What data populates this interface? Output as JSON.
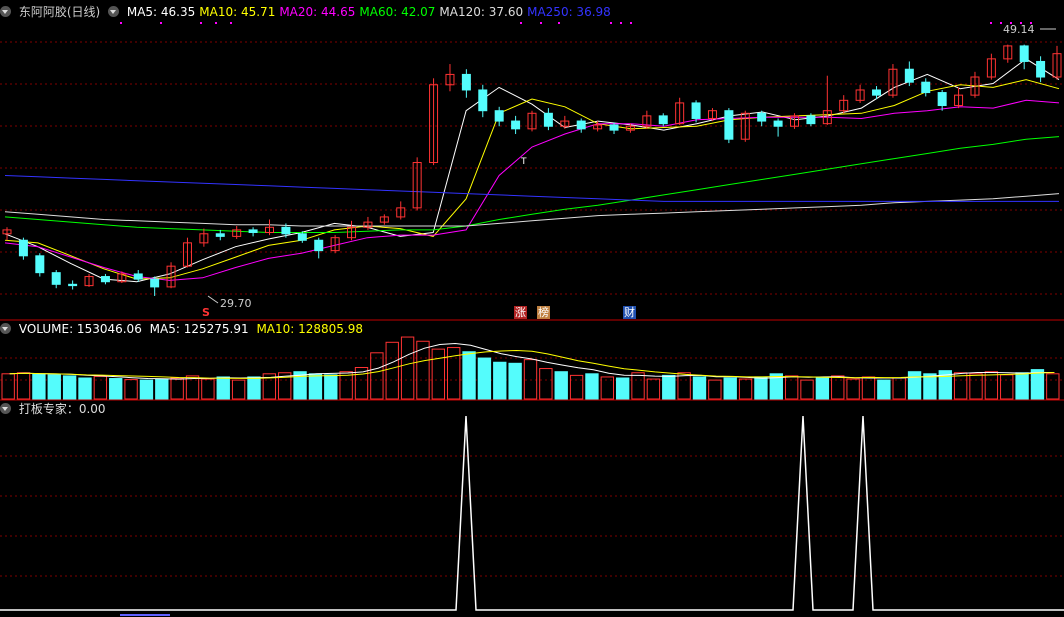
{
  "header": {
    "title": "东阿阿胶(日线)",
    "ma": [
      {
        "label": "MA5: 46.35",
        "color": "#ffffff"
      },
      {
        "label": "MA10: 45.71",
        "color": "#ffff00"
      },
      {
        "label": "MA20: 44.65",
        "color": "#ff00ff"
      },
      {
        "label": "MA60: 42.07",
        "color": "#00ff00"
      },
      {
        "label": "MA120: 37.60",
        "color": "#dddddd"
      },
      {
        "label": "MA250: 36.98",
        "color": "#3333ff"
      }
    ]
  },
  "volume_header": {
    "title": "VOLUME: 153046.06",
    "ma5": "MA5: 125275.91",
    "ma10": "MA10: 128805.98"
  },
  "indicator_header": {
    "title": "打板专家：0.00"
  },
  "annotations": {
    "high_label": "49.14",
    "low_label": "29.70",
    "s_marker": "S",
    "t_marker": "T",
    "zhang": "涨",
    "bang": "榜",
    "cai": "财"
  },
  "colors": {
    "up": "#ff3333",
    "down": "#54fcfc",
    "grid": "#800000"
  },
  "chart_data": [
    {
      "type": "line",
      "title": "东阿阿胶(日线)",
      "note": "price panel; values read approximately, right-most is latest",
      "ylim": [
        28,
        51
      ],
      "series": [
        {
          "name": "MA5",
          "values": [
            34.5,
            33.5,
            32.2,
            31.0,
            30.8,
            31.4,
            32.5,
            33.5,
            34.1,
            34.6,
            35.3,
            35.0,
            34.3,
            34.6,
            44.0,
            45.8,
            44.5,
            42.7,
            43.2,
            42.9,
            42.5,
            43.0,
            43.6,
            43.9,
            43.3,
            43.6,
            44.2,
            45.8,
            46.8,
            45.7,
            46.1,
            48.0,
            46.4
          ]
        },
        {
          "name": "MA10",
          "values": [
            34.0,
            33.8,
            32.8,
            31.8,
            31.0,
            31.1,
            31.8,
            32.7,
            33.6,
            34.0,
            34.8,
            35.1,
            34.9,
            34.3,
            37.2,
            43.8,
            44.9,
            44.3,
            43.0,
            42.6,
            42.7,
            42.8,
            43.3,
            43.5,
            43.6,
            43.7,
            43.8,
            44.4,
            45.5,
            46.0,
            45.8,
            46.4,
            45.7
          ]
        },
        {
          "name": "MA20",
          "values": [
            33.8,
            33.5,
            32.7,
            31.9,
            31.2,
            30.9,
            31.1,
            31.9,
            32.6,
            33.0,
            33.6,
            34.2,
            34.4,
            34.4,
            34.8,
            39.0,
            41.2,
            42.2,
            43.0,
            43.0,
            42.8,
            43.3,
            43.4,
            43.5,
            43.5,
            43.5,
            43.4,
            43.8,
            44.0,
            44.3,
            44.2,
            44.8,
            44.6
          ]
        },
        {
          "name": "MA60",
          "values": [
            35.8,
            35.6,
            35.4,
            35.2,
            35.0,
            34.9,
            34.8,
            34.7,
            34.6,
            34.6,
            34.6,
            34.7,
            34.8,
            34.8,
            35.1,
            35.6,
            36.0,
            36.4,
            36.7,
            37.1,
            37.5,
            37.9,
            38.3,
            38.7,
            39.1,
            39.5,
            39.9,
            40.3,
            40.7,
            41.1,
            41.4,
            41.8,
            42.0
          ]
        },
        {
          "name": "MA120",
          "values": [
            36.2,
            36.0,
            35.8,
            35.6,
            35.5,
            35.4,
            35.3,
            35.2,
            35.2,
            35.1,
            35.1,
            35.1,
            35.1,
            35.1,
            35.1,
            35.3,
            35.5,
            35.7,
            35.9,
            36.0,
            36.1,
            36.2,
            36.3,
            36.4,
            36.5,
            36.6,
            36.7,
            36.9,
            37.0,
            37.1,
            37.2,
            37.4,
            37.6
          ]
        },
        {
          "name": "MA250",
          "values": [
            39.0,
            38.9,
            38.8,
            38.7,
            38.6,
            38.5,
            38.4,
            38.3,
            38.2,
            38.1,
            38.0,
            37.9,
            37.8,
            37.7,
            37.6,
            37.5,
            37.4,
            37.3,
            37.2,
            37.1,
            37.0,
            37.0,
            37.0,
            37.0,
            37.0,
            37.0,
            37.0,
            37.0,
            37.0,
            37.0,
            37.0,
            37.0,
            37.0
          ]
        }
      ],
      "candles": [
        [
          34.5,
          34.8,
          34.0,
          35.0
        ],
        [
          34.0,
          32.8,
          32.5,
          34.2
        ],
        [
          32.8,
          31.5,
          31.2,
          33.0
        ],
        [
          31.5,
          30.6,
          30.3,
          31.7
        ],
        [
          30.6,
          30.5,
          30.2,
          30.9
        ],
        [
          30.5,
          31.2,
          30.4,
          31.4
        ],
        [
          31.2,
          30.8,
          30.6,
          31.4
        ],
        [
          30.8,
          31.4,
          30.7,
          31.6
        ],
        [
          31.4,
          31.0,
          30.8,
          31.7
        ],
        [
          31.0,
          30.4,
          29.7,
          31.2
        ],
        [
          30.4,
          32.0,
          30.3,
          32.3
        ],
        [
          32.0,
          33.8,
          31.9,
          34.2
        ],
        [
          33.8,
          34.5,
          33.5,
          34.9
        ],
        [
          34.5,
          34.3,
          34.0,
          34.8
        ],
        [
          34.3,
          34.8,
          34.1,
          35.1
        ],
        [
          34.8,
          34.6,
          34.3,
          35.0
        ],
        [
          34.6,
          35.0,
          34.4,
          35.6
        ],
        [
          35.0,
          34.5,
          34.2,
          35.3
        ],
        [
          34.5,
          34.0,
          33.8,
          34.7
        ],
        [
          34.0,
          33.2,
          32.6,
          34.2
        ],
        [
          33.2,
          34.2,
          33.0,
          34.4
        ],
        [
          34.2,
          35.0,
          34.0,
          35.5
        ],
        [
          35.0,
          35.4,
          34.8,
          35.8
        ],
        [
          35.4,
          35.8,
          35.2,
          36.0
        ],
        [
          35.8,
          36.5,
          35.6,
          37.0
        ],
        [
          36.5,
          40.0,
          36.3,
          40.4
        ],
        [
          40.0,
          46.0,
          39.8,
          46.5
        ],
        [
          46.0,
          46.8,
          45.5,
          47.6
        ],
        [
          46.8,
          45.6,
          45.0,
          47.2
        ],
        [
          45.6,
          44.0,
          43.5,
          46.0
        ],
        [
          44.0,
          43.2,
          42.8,
          44.3
        ],
        [
          43.2,
          42.6,
          42.2,
          43.6
        ],
        [
          42.6,
          43.8,
          42.4,
          44.0
        ],
        [
          43.8,
          42.8,
          42.5,
          44.2
        ],
        [
          42.8,
          43.2,
          42.6,
          43.6
        ],
        [
          43.2,
          42.6,
          42.3,
          43.4
        ],
        [
          42.6,
          42.9,
          42.4,
          43.2
        ],
        [
          42.9,
          42.5,
          42.2,
          43.1
        ],
        [
          42.5,
          42.8,
          42.3,
          43.0
        ],
        [
          42.8,
          43.6,
          42.6,
          44.0
        ],
        [
          43.6,
          43.0,
          42.8,
          43.8
        ],
        [
          43.0,
          44.6,
          42.9,
          45.0
        ],
        [
          44.6,
          43.4,
          43.1,
          44.8
        ],
        [
          43.4,
          44.0,
          43.2,
          44.2
        ],
        [
          44.0,
          41.8,
          41.5,
          44.2
        ],
        [
          41.8,
          43.8,
          41.6,
          44.0
        ],
        [
          43.8,
          43.2,
          42.8,
          44.0
        ],
        [
          43.2,
          42.8,
          42.0,
          43.4
        ],
        [
          42.8,
          43.6,
          42.6,
          43.8
        ],
        [
          43.6,
          43.0,
          42.8,
          43.8
        ],
        [
          43.0,
          44.0,
          42.9,
          46.7
        ],
        [
          44.0,
          44.8,
          43.8,
          45.2
        ],
        [
          44.8,
          45.6,
          44.6,
          46.0
        ],
        [
          45.6,
          45.2,
          44.9,
          45.9
        ],
        [
          45.2,
          47.2,
          45.0,
          47.6
        ],
        [
          47.2,
          46.2,
          45.9,
          47.8
        ],
        [
          46.2,
          45.4,
          45.1,
          46.5
        ],
        [
          45.4,
          44.4,
          44.0,
          45.6
        ],
        [
          44.4,
          45.2,
          44.2,
          45.8
        ],
        [
          45.2,
          46.6,
          45.0,
          47.0
        ],
        [
          46.6,
          48.0,
          46.4,
          48.4
        ],
        [
          48.0,
          49.0,
          47.7,
          49.1
        ],
        [
          49.0,
          47.8,
          47.2,
          49.1
        ],
        [
          47.8,
          46.6,
          46.2,
          48.2
        ],
        [
          46.6,
          48.4,
          46.4,
          49.0
        ]
      ]
    },
    {
      "type": "bar",
      "title": "VOLUME: 153046.06",
      "ylim": [
        0,
        130000
      ],
      "note": "volume panel, relative bar heights",
      "values": [
        48,
        50,
        47,
        46,
        44,
        40,
        43,
        39,
        37,
        36,
        38,
        40,
        44,
        38,
        42,
        36,
        42,
        48,
        50,
        52,
        48,
        46,
        52,
        60,
        88,
        108,
        118,
        110,
        95,
        98,
        90,
        78,
        70,
        68,
        75,
        58,
        52,
        45,
        48,
        42,
        40,
        50,
        38,
        45,
        50,
        42,
        36,
        40,
        38,
        42,
        48,
        44,
        36,
        40,
        44,
        38,
        42,
        36,
        40,
        52,
        48,
        54,
        50,
        48,
        52,
        46,
        50,
        56,
        48
      ]
    },
    {
      "type": "line",
      "title": "打板专家：0.00",
      "ylim": [
        0,
        1
      ],
      "x": [
        0,
        456,
        466,
        476,
        793,
        803,
        813,
        853,
        863,
        873,
        1064
      ],
      "values": [
        0,
        0,
        1,
        0,
        0,
        1,
        0,
        0,
        1,
        0,
        0
      ]
    }
  ]
}
